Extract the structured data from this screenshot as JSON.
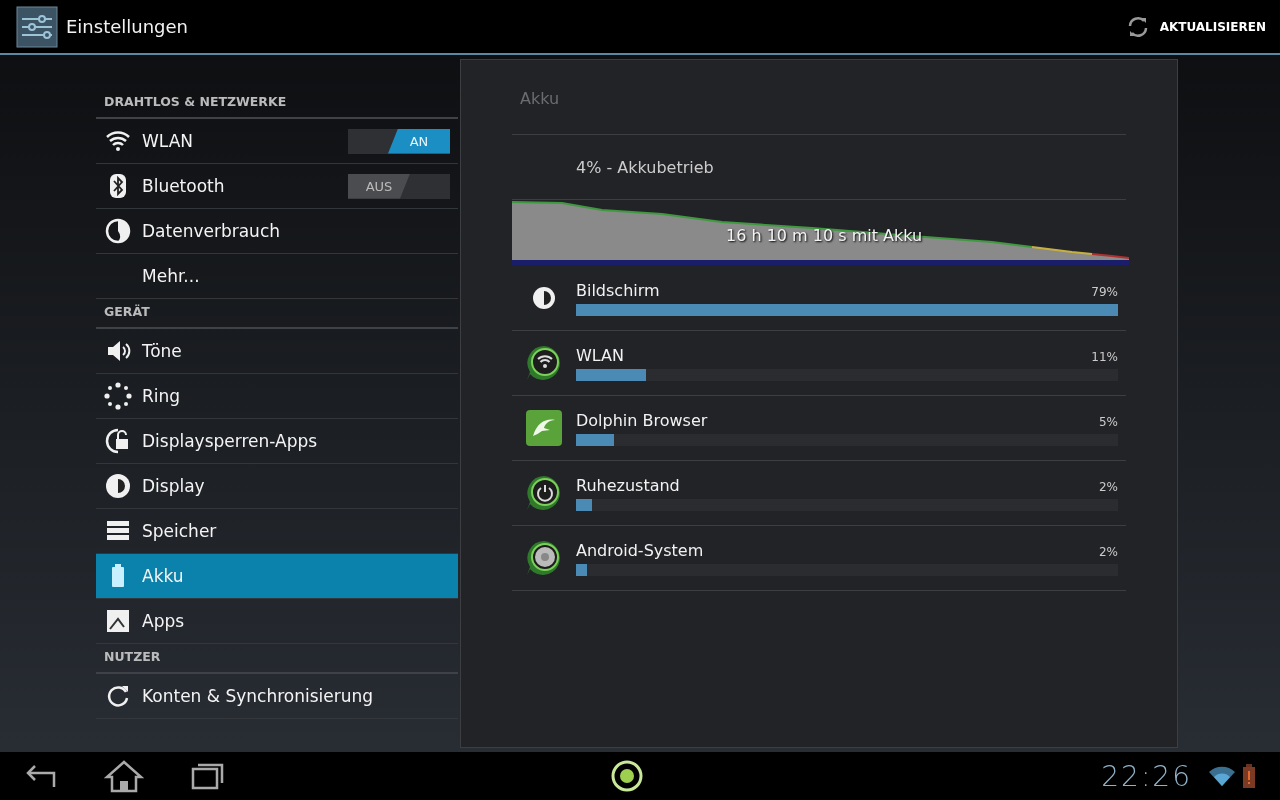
{
  "app_bar": {
    "title": "Einstellungen",
    "action": "AKTUALISIEREN"
  },
  "sidebar": {
    "sections": [
      {
        "header": "DRAHTLOS & NETZWERKE",
        "items": [
          {
            "label": "WLAN",
            "kind": "toggle",
            "switch": {
              "text": "AN",
              "on": true
            },
            "selected": false
          },
          {
            "label": "Bluetooth",
            "kind": "toggle",
            "switch": {
              "text": "AUS",
              "on": false
            },
            "selected": false
          },
          {
            "label": "Datenverbrauch",
            "kind": "plain",
            "selected": false
          },
          {
            "label": "Mehr...",
            "kind": "plain",
            "selected": false
          }
        ]
      },
      {
        "header": "GERÄT",
        "items": [
          {
            "label": "Töne",
            "kind": "plain",
            "selected": false
          },
          {
            "label": "Ring",
            "kind": "plain",
            "selected": false
          },
          {
            "label": "Displaysperren-Apps",
            "kind": "plain",
            "selected": false
          },
          {
            "label": "Display",
            "kind": "plain",
            "selected": false
          },
          {
            "label": "Speicher",
            "kind": "plain",
            "selected": false
          },
          {
            "label": "Akku",
            "kind": "plain",
            "selected": true
          },
          {
            "label": "Apps",
            "kind": "plain",
            "selected": false
          }
        ]
      },
      {
        "header": "NUTZER",
        "items": [
          {
            "label": "Konten & Synchronisierung",
            "kind": "plain",
            "selected": false
          }
        ]
      }
    ]
  },
  "battery": {
    "title": "Akku",
    "status": "4% - Akkubetrieb",
    "duration": "16 h 10 m 10 s mit Akku",
    "usage": [
      {
        "name": "Bildschirm",
        "percent": "79%",
        "level": 1.0
      },
      {
        "name": "WLAN",
        "percent": "11%",
        "level": 0.13
      },
      {
        "name": "Dolphin Browser",
        "percent": "5%",
        "level": 0.07
      },
      {
        "name": "Ruhezustand",
        "percent": "2%",
        "level": 0.03
      },
      {
        "name": "Android-System",
        "percent": "2%",
        "level": 0.02
      }
    ]
  },
  "nav_bar": {
    "clock": "22:26"
  }
}
